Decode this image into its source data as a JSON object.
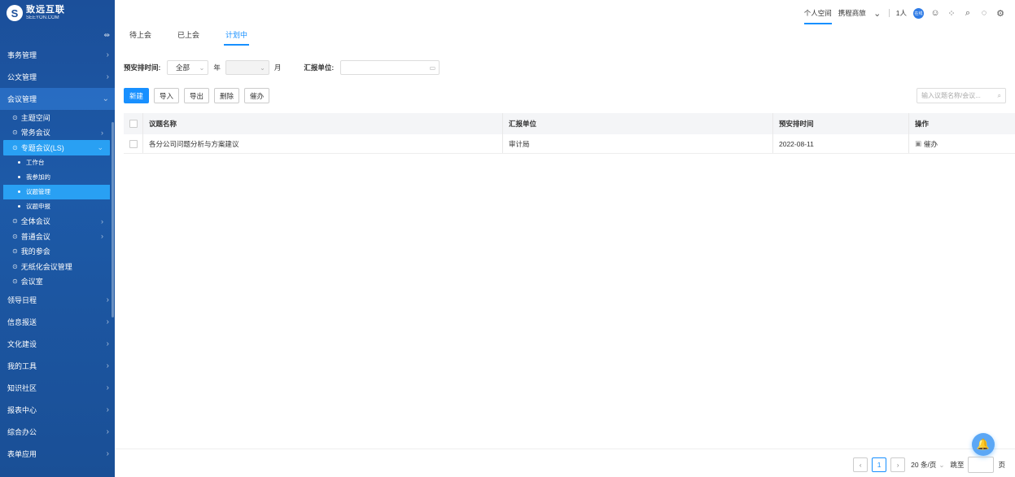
{
  "brand": {
    "name": "致远互联",
    "sub": "SEEYON.COM"
  },
  "sidebar": {
    "top_items": [
      {
        "label": "事务管理"
      },
      {
        "label": "公文管理"
      },
      {
        "label": "会议管理"
      }
    ],
    "meeting_sub": [
      {
        "label": "主题空间"
      },
      {
        "label": "常务会议"
      },
      {
        "label": "专题会议(LS)"
      }
    ],
    "leaves": [
      {
        "label": "工作台"
      },
      {
        "label": "我参加的"
      },
      {
        "label": "议题管理"
      },
      {
        "label": "议题申报"
      }
    ],
    "meeting_sub2": [
      {
        "label": "全体会议"
      },
      {
        "label": "普通会议"
      },
      {
        "label": "我的参会"
      },
      {
        "label": "无纸化会议管理"
      },
      {
        "label": "会议室"
      }
    ],
    "bottom_items": [
      {
        "label": "领导日程"
      },
      {
        "label": "信息报送"
      },
      {
        "label": "文化建设"
      },
      {
        "label": "我的工具"
      },
      {
        "label": "知识社区"
      },
      {
        "label": "报表中心"
      },
      {
        "label": "综合办公"
      },
      {
        "label": "表单应用"
      }
    ]
  },
  "topbar": {
    "personal_space": "个人空间",
    "group_space": "携程商旅",
    "online": "1人",
    "badge": "在线"
  },
  "tabs": [
    {
      "label": "待上会"
    },
    {
      "label": "已上会"
    },
    {
      "label": "计划中"
    }
  ],
  "filter": {
    "time_label": "预安排时间:",
    "year_value": "全部",
    "year_unit": "年",
    "month_unit": "月",
    "unit_label": "汇报单位:"
  },
  "actions": {
    "new": "新建",
    "import": "导入",
    "export": "导出",
    "delete": "删除",
    "urge": "催办"
  },
  "search": {
    "placeholder": "输入议题名称/会议..."
  },
  "table": {
    "headers": [
      "议题名称",
      "汇报单位",
      "预安排时间",
      "操作"
    ],
    "rows": [
      {
        "name": "各分公司问题分析与方案建议",
        "unit": "审计局",
        "time": "2022-08-11",
        "op": "催办"
      }
    ]
  },
  "pager": {
    "current": "1",
    "size": "20 条/页",
    "jump": "跳至",
    "page": "页"
  }
}
